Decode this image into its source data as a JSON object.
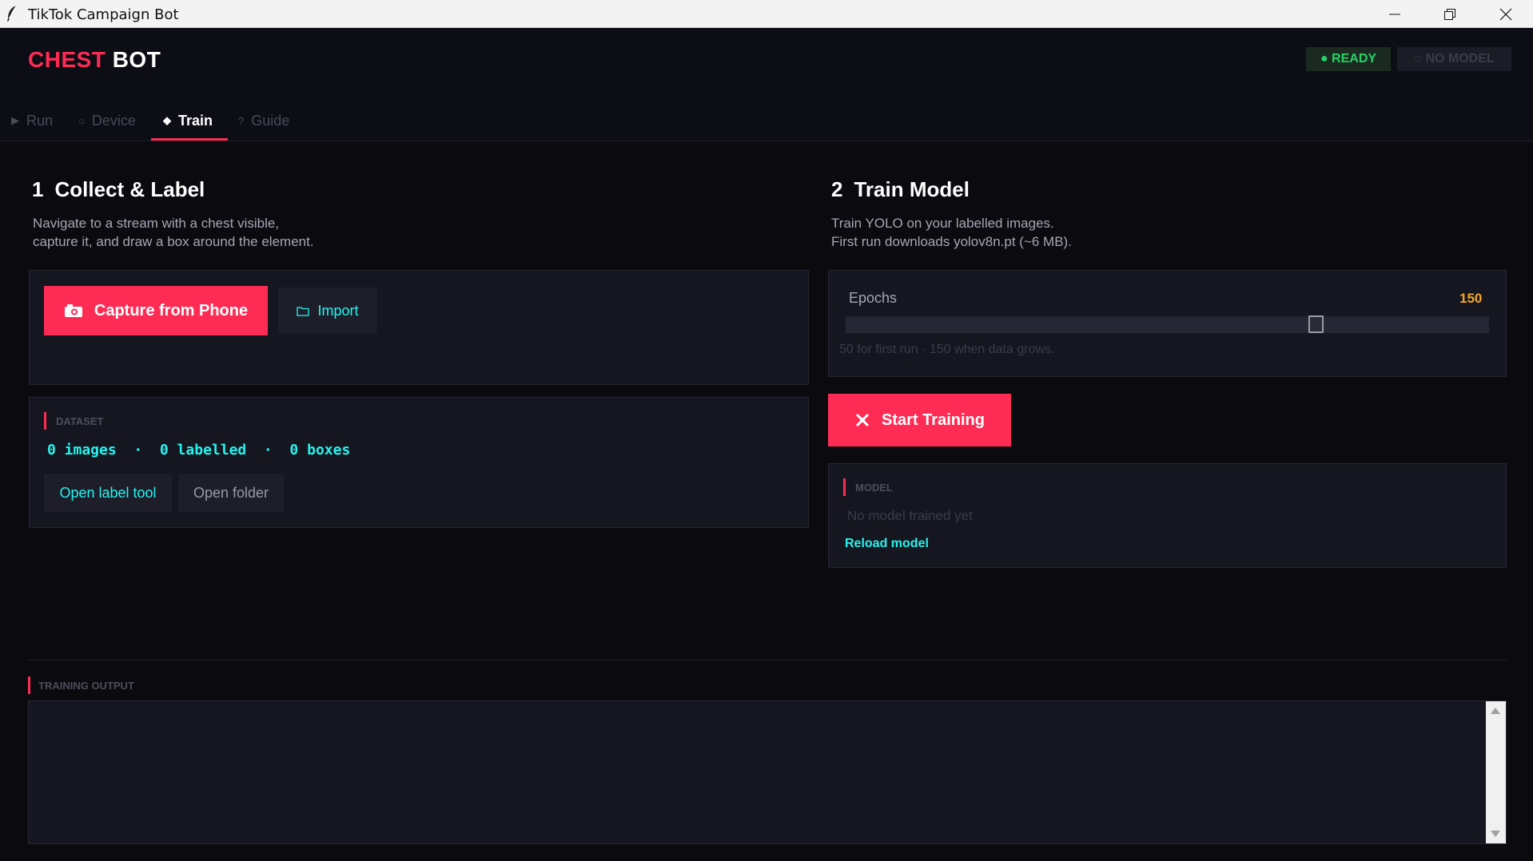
{
  "window": {
    "title": "TikTok Campaign Bot"
  },
  "header": {
    "logo_part1": "CHEST",
    "logo_part2": "BOT",
    "status_ready": "● READY",
    "status_model": "○ NO MODEL"
  },
  "tabs": [
    {
      "icon": "▶",
      "label": "Run"
    },
    {
      "icon": "○",
      "label": "Device"
    },
    {
      "icon": "◆",
      "label": "Train"
    },
    {
      "icon": "?",
      "label": "Guide"
    }
  ],
  "active_tab": "Train",
  "collect": {
    "num": "1",
    "title": "Collect & Label",
    "desc_line1": "Navigate to a stream with a chest visible,",
    "desc_line2": "capture it, and draw a box around the element.",
    "capture_label": "Capture from Phone",
    "import_label": "Import"
  },
  "dataset": {
    "section_label": "DATASET",
    "stats": "0 images  ·  0 labelled  ·  0 boxes",
    "open_label_tool": "Open label tool",
    "open_folder": "Open folder"
  },
  "train": {
    "num": "2",
    "title": "Train Model",
    "desc_line1": "Train YOLO on your labelled images.",
    "desc_line2": "First run downloads yolov8n.pt (~6 MB).",
    "epochs_label": "Epochs",
    "epochs_value": "150",
    "epochs_fraction": 0.73,
    "epochs_hint": "50 for first run · 150 when data grows.",
    "start_label": "Start Training"
  },
  "model": {
    "section_label": "MODEL",
    "status": "No model trained yet",
    "reload_label": "Reload model"
  },
  "output": {
    "section_label": "TRAINING OUTPUT"
  },
  "colors": {
    "accent": "#fe2c55",
    "cyan": "#25f4ee",
    "ready_green": "#25d366",
    "epochs_value": "#f5a623",
    "background": "#0a0a0f",
    "panel": "#161620"
  }
}
